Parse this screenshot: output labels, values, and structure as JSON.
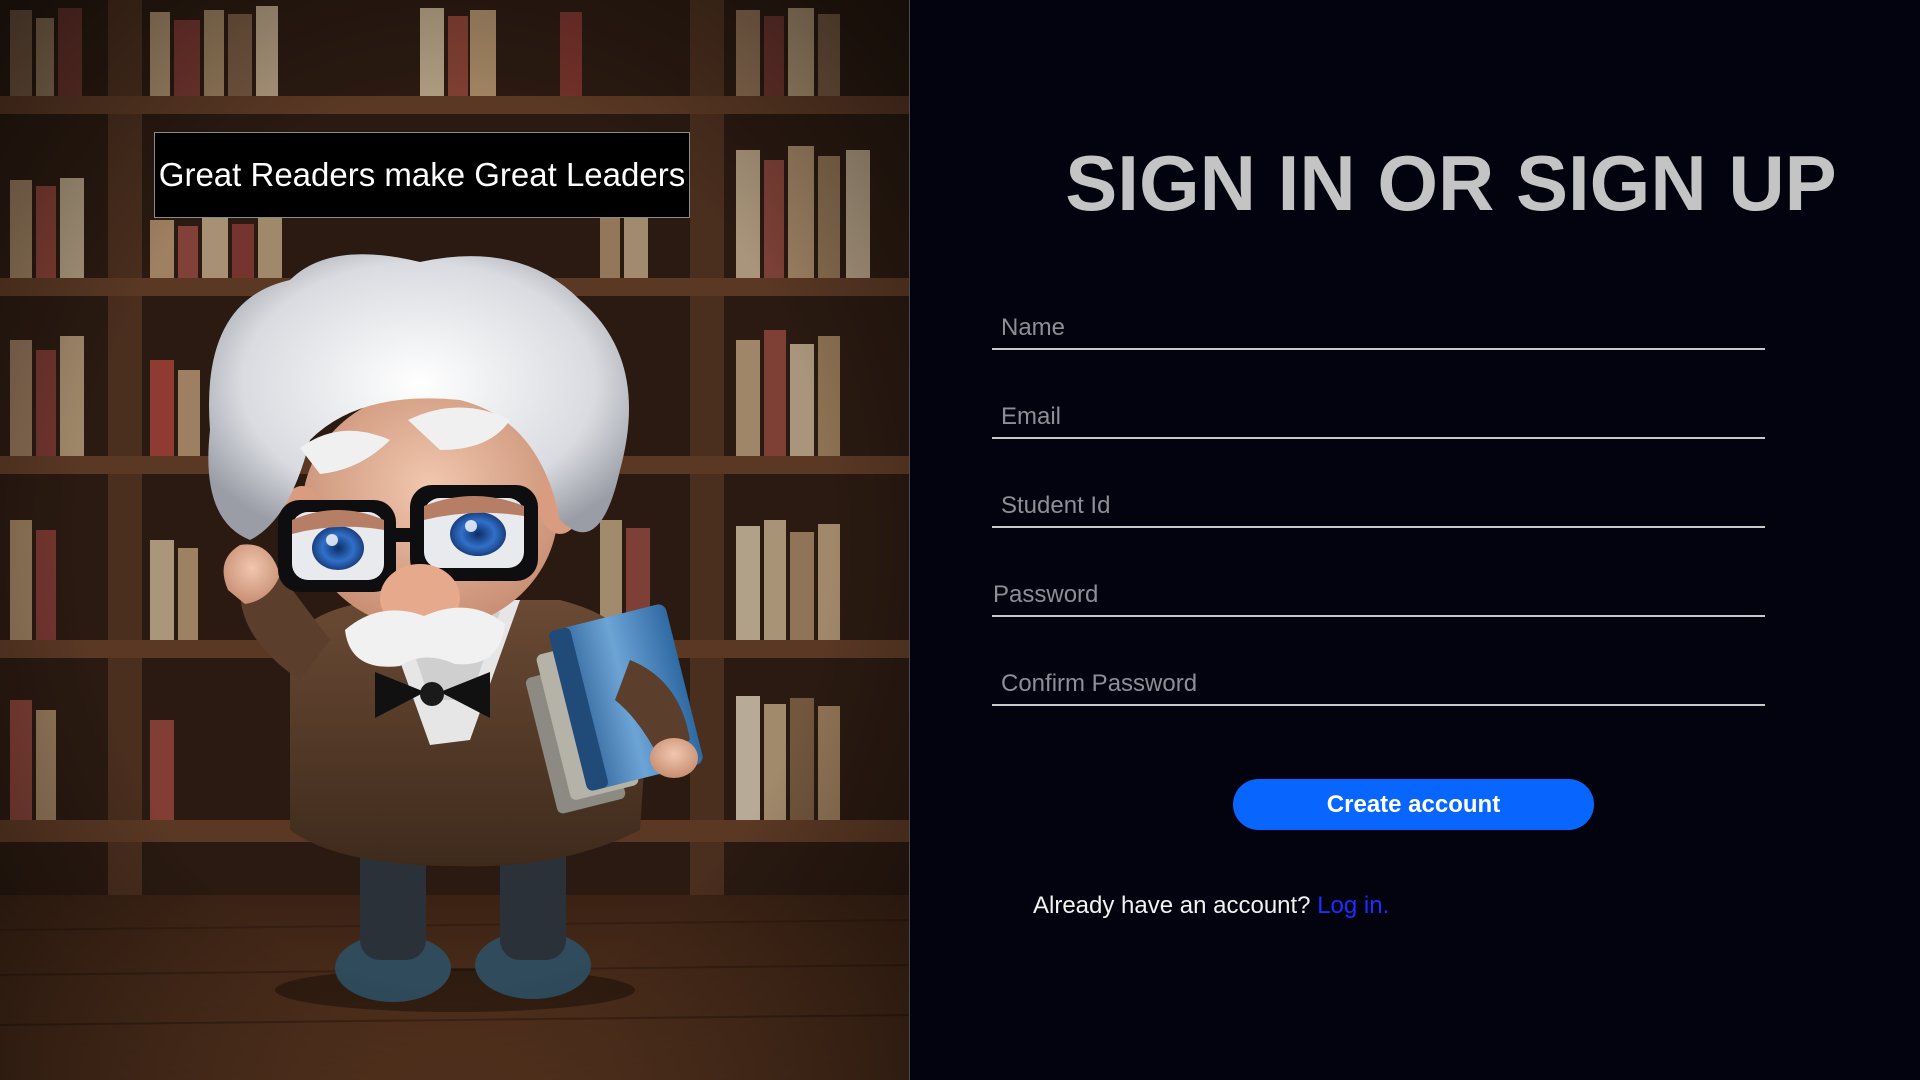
{
  "hero": {
    "quote": "Great Readers make Great Leaders"
  },
  "form": {
    "title": "SIGN IN OR SIGN UP",
    "fields": {
      "name": {
        "placeholder": "Name",
        "value": ""
      },
      "email": {
        "placeholder": "Email",
        "value": ""
      },
      "student_id": {
        "placeholder": "Student Id",
        "value": ""
      },
      "password": {
        "placeholder": "Password",
        "value": ""
      },
      "confirm_password": {
        "placeholder": "Confirm Password",
        "value": ""
      }
    },
    "submit_label": "Create account",
    "login_prompt": "Already have an account?",
    "login_link": "Log in."
  },
  "colors": {
    "background": "#03030f",
    "title": "#c4c4c4",
    "button": "#0866ff",
    "link": "#1a2fff"
  },
  "icons": {
    "hero_image": "old-scholar-with-books-illustration"
  }
}
